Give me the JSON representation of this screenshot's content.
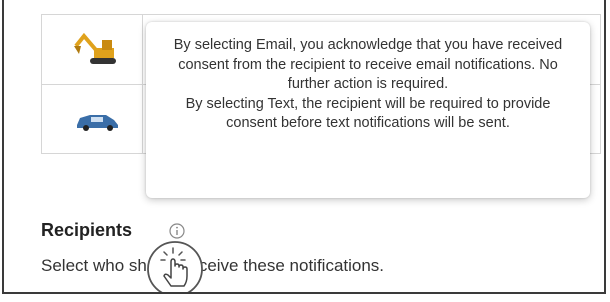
{
  "table": {
    "rows": [
      {
        "thumbnail": "excavator-thumbnail"
      },
      {
        "thumbnail": "vehicle-thumbnail"
      }
    ]
  },
  "tooltip": {
    "email_text": "By selecting Email, you acknowledge that you have received consent from the recipient to receive email notifications. No further action is required.",
    "text_text": "By selecting Text, the recipient will be required to provide consent before text notifications will be sent."
  },
  "recipients": {
    "title": "Recipients",
    "description": "Select who should receive these notifications.",
    "info_icon": "info-icon"
  },
  "cursor": {
    "icon": "hand-pointer-icon"
  },
  "colors": {
    "border": "#3a3a3a",
    "grid": "#d6d6d6",
    "excavator": "#e0a21c",
    "vehicle": "#3a6ea8"
  }
}
